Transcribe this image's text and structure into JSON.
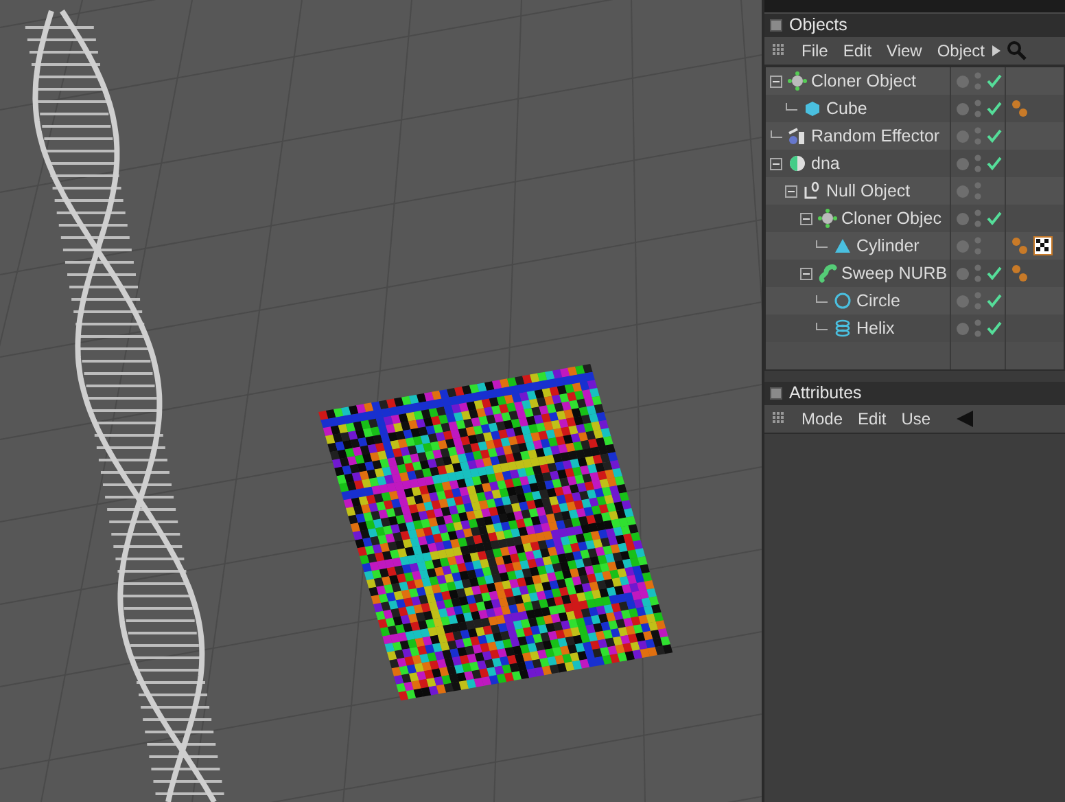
{
  "objects_panel": {
    "title": "Objects",
    "menu": [
      "File",
      "Edit",
      "View",
      "Object"
    ],
    "tree": [
      {
        "name": "Cloner Object",
        "kind": "cloner",
        "checked": true,
        "expanded": true,
        "children": [
          {
            "name": "Cube",
            "kind": "cube",
            "checked": true,
            "tags": [
              {
                "kind": "material"
              }
            ]
          }
        ]
      },
      {
        "name": "Random Effector",
        "kind": "effector",
        "checked": true
      },
      {
        "name": "dna",
        "kind": "sphere",
        "checked": true,
        "expanded": true,
        "children": [
          {
            "name": "Null Object",
            "kind": "null",
            "checked": false,
            "expanded": true,
            "children": [
              {
                "name": "Cloner Objec",
                "kind": "cloner",
                "checked": true,
                "expanded": true,
                "children": [
                  {
                    "name": "Cylinder",
                    "kind": "cylinder",
                    "checked": false,
                    "tags": [
                      {
                        "kind": "material"
                      },
                      {
                        "kind": "texture"
                      }
                    ]
                  }
                ]
              },
              {
                "name": "Sweep NURB",
                "kind": "sweep",
                "checked": true,
                "expanded": true,
                "tags": [
                  {
                    "kind": "material"
                  }
                ],
                "children": [
                  {
                    "name": "Circle",
                    "kind": "circle",
                    "checked": true
                  },
                  {
                    "name": "Helix",
                    "kind": "helix",
                    "checked": true
                  }
                ]
              }
            ]
          }
        ]
      }
    ]
  },
  "attributes_panel": {
    "title": "Attributes",
    "menu": [
      "Mode",
      "Edit",
      "Use"
    ]
  }
}
